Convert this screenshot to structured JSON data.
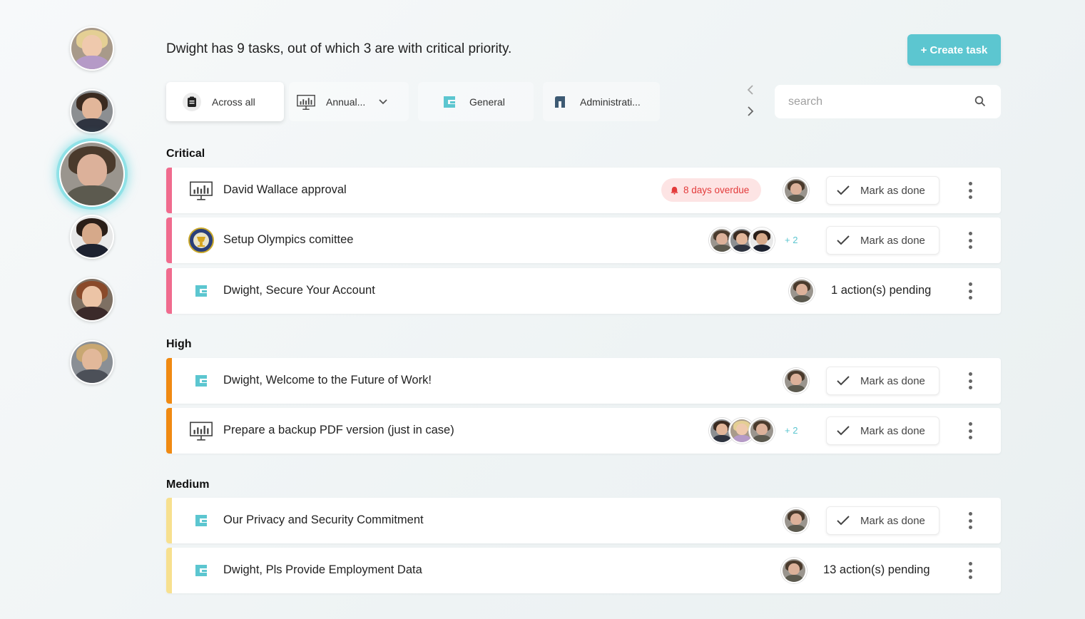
{
  "headline": "Dwight has 9 tasks, out of which 3 are with critical priority.",
  "create_button": "+ Create task",
  "tabs": [
    {
      "label": "Across all",
      "icon": "clipboard-icon"
    },
    {
      "label": "Annual...",
      "icon": "presentation-chart-icon"
    },
    {
      "label": "General",
      "icon": "g-logo-icon"
    },
    {
      "label": "Administrati...",
      "icon": "a-logo-icon"
    }
  ],
  "search": {
    "placeholder": "search"
  },
  "sections": {
    "critical": "Critical",
    "high": "High",
    "medium": "Medium"
  },
  "tasks": {
    "t1": {
      "title": "David Wallace approval",
      "overdue": "8 days overdue",
      "action": "Mark as done"
    },
    "t2": {
      "title": "Setup Olympics comittee",
      "extra": "+ 2",
      "action": "Mark as done"
    },
    "t3": {
      "title": "Dwight, Secure Your Account",
      "pending": "1 action(s) pending"
    },
    "t4": {
      "title": "Dwight, Welcome to the Future of Work!",
      "action": "Mark as done"
    },
    "t5": {
      "title": "Prepare a backup PDF version (just in case)",
      "extra": "+ 2",
      "action": "Mark as done"
    },
    "t6": {
      "title": "Our Privacy and Security Commitment",
      "action": "Mark as done"
    },
    "t7": {
      "title": "Dwight, Pls Provide Employment Data",
      "pending": "13 action(s) pending"
    }
  },
  "colors": {
    "accent": "#5cc6d0",
    "critical": "#f06b8e",
    "high": "#f08a12",
    "medium": "#f7e08f",
    "overdue_text": "#e33b3b",
    "overdue_bg": "#fde4e4"
  }
}
